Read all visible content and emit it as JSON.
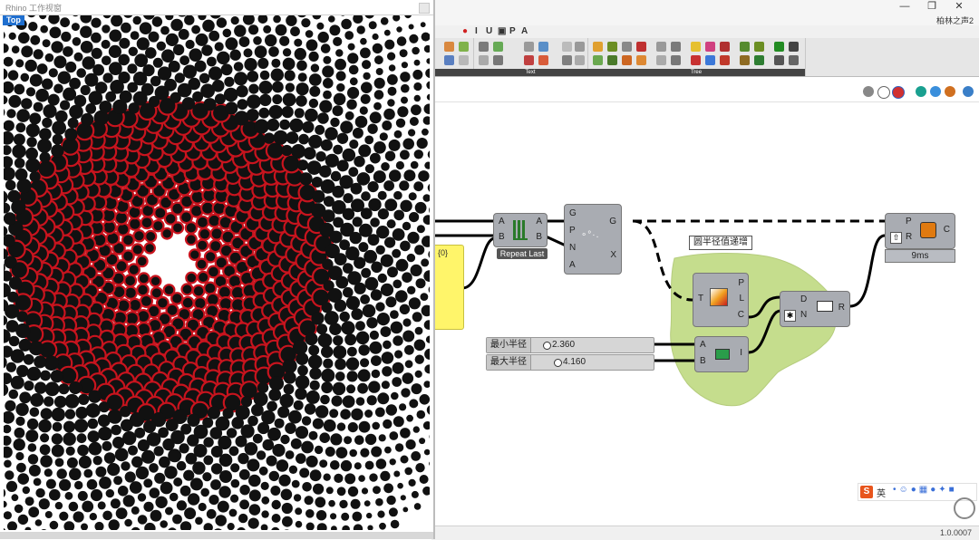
{
  "rhino": {
    "title": "Rhino 工作视窗",
    "view_name": "Top"
  },
  "grasshopper": {
    "title": "柏林之声2",
    "menu": [
      "I",
      "U",
      "P",
      "A"
    ],
    "ribbon_groups": [
      "Text",
      "Tree"
    ],
    "components": {
      "repeat_last": "Repeat Last",
      "panel_value": "{0}",
      "ribbon_label": "圆半径值递增",
      "timer_label": "9ms"
    },
    "sliders": [
      {
        "name": "最小半径",
        "value": "2.360"
      },
      {
        "name": "最大半径",
        "value": "4.160"
      }
    ],
    "ime": {
      "label": "英"
    },
    "status": {
      "version": "1.0.0007"
    }
  },
  "colors": {
    "dot_black": "#111111",
    "dot_red": "#c8141e",
    "group_green": "#c5dd8d",
    "panel_yellow": "#fff56a"
  }
}
